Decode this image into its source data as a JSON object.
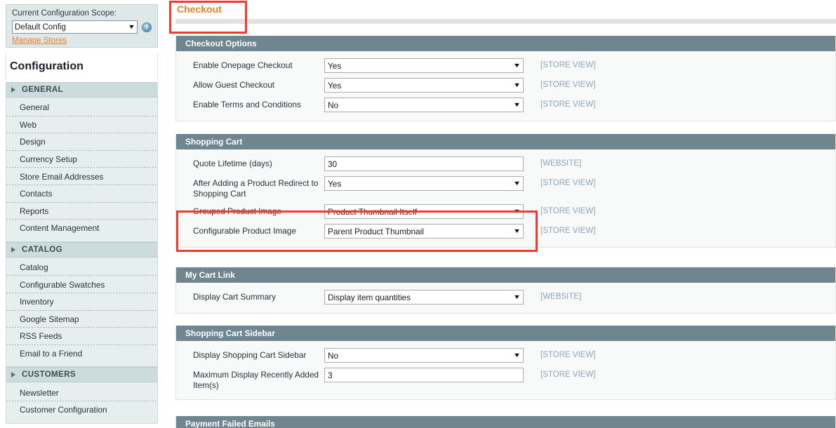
{
  "sidebar": {
    "scope": {
      "label": "Current Configuration Scope:",
      "selected": "Default Config",
      "caret": "▼",
      "help_icon": "?",
      "manage_stores_link": "Manage Stores"
    },
    "title": "Configuration",
    "groups": [
      {
        "label": "GENERAL",
        "items": [
          {
            "label": "General"
          },
          {
            "label": "Web"
          },
          {
            "label": "Design"
          },
          {
            "label": "Currency Setup"
          },
          {
            "label": "Store Email Addresses"
          },
          {
            "label": "Contacts"
          },
          {
            "label": "Reports"
          },
          {
            "label": "Content Management"
          }
        ]
      },
      {
        "label": "CATALOG",
        "items": [
          {
            "label": "Catalog"
          },
          {
            "label": "Configurable Swatches"
          },
          {
            "label": "Inventory"
          },
          {
            "label": "Google Sitemap"
          },
          {
            "label": "RSS Feeds"
          },
          {
            "label": "Email to a Friend"
          }
        ]
      },
      {
        "label": "CUSTOMERS",
        "items": [
          {
            "label": "Newsletter"
          },
          {
            "label": "Customer Configuration"
          }
        ]
      }
    ]
  },
  "content": {
    "tab": {
      "label": "Checkout"
    },
    "sections": [
      {
        "title": "Checkout Options",
        "fields": [
          {
            "label": "Enable Onepage Checkout",
            "type": "select",
            "value": "Yes",
            "caret": "▼",
            "scope": "[STORE VIEW]"
          },
          {
            "label": "Allow Guest Checkout",
            "type": "select",
            "value": "Yes",
            "caret": "▼",
            "scope": "[STORE VIEW]"
          },
          {
            "label": "Enable Terms and Conditions",
            "type": "select",
            "value": "No",
            "caret": "▼",
            "scope": "[STORE VIEW]"
          }
        ]
      },
      {
        "title": "Shopping Cart",
        "fields": [
          {
            "label": "Quote Lifetime (days)",
            "type": "text",
            "value": "30",
            "caret": "",
            "scope": "[WEBSITE]"
          },
          {
            "label": "After Adding a Product Redirect to Shopping Cart",
            "type": "select",
            "value": "Yes",
            "caret": "▼",
            "scope": "[STORE VIEW]"
          },
          {
            "label": "Grouped Product Image",
            "type": "select",
            "value": "Product Thumbnail Itself",
            "caret": "▼",
            "scope": "[STORE VIEW]"
          },
          {
            "label": "Configurable Product Image",
            "type": "select",
            "value": "Parent Product Thumbnail",
            "caret": "▼",
            "scope": "[STORE VIEW]"
          }
        ]
      },
      {
        "title": "My Cart Link",
        "fields": [
          {
            "label": "Display Cart Summary",
            "type": "select",
            "value": "Display item quantities",
            "caret": "▼",
            "scope": "[WEBSITE]"
          }
        ]
      },
      {
        "title": "Shopping Cart Sidebar",
        "fields": [
          {
            "label": "Display Shopping Cart Sidebar",
            "type": "select",
            "value": "No",
            "caret": "▼",
            "scope": "[STORE VIEW]"
          },
          {
            "label": "Maximum Display Recently Added Item(s)",
            "type": "text",
            "value": "3",
            "caret": "",
            "scope": "[STORE VIEW]"
          }
        ]
      },
      {
        "title": "Payment Failed Emails",
        "fields": []
      }
    ]
  },
  "colors": {
    "section_header": "#6f8691",
    "highlight_border": "#f5392b",
    "tab_text": "#ee7c25",
    "link": "#eb7b27",
    "scope_text": "#8fa3b3"
  }
}
